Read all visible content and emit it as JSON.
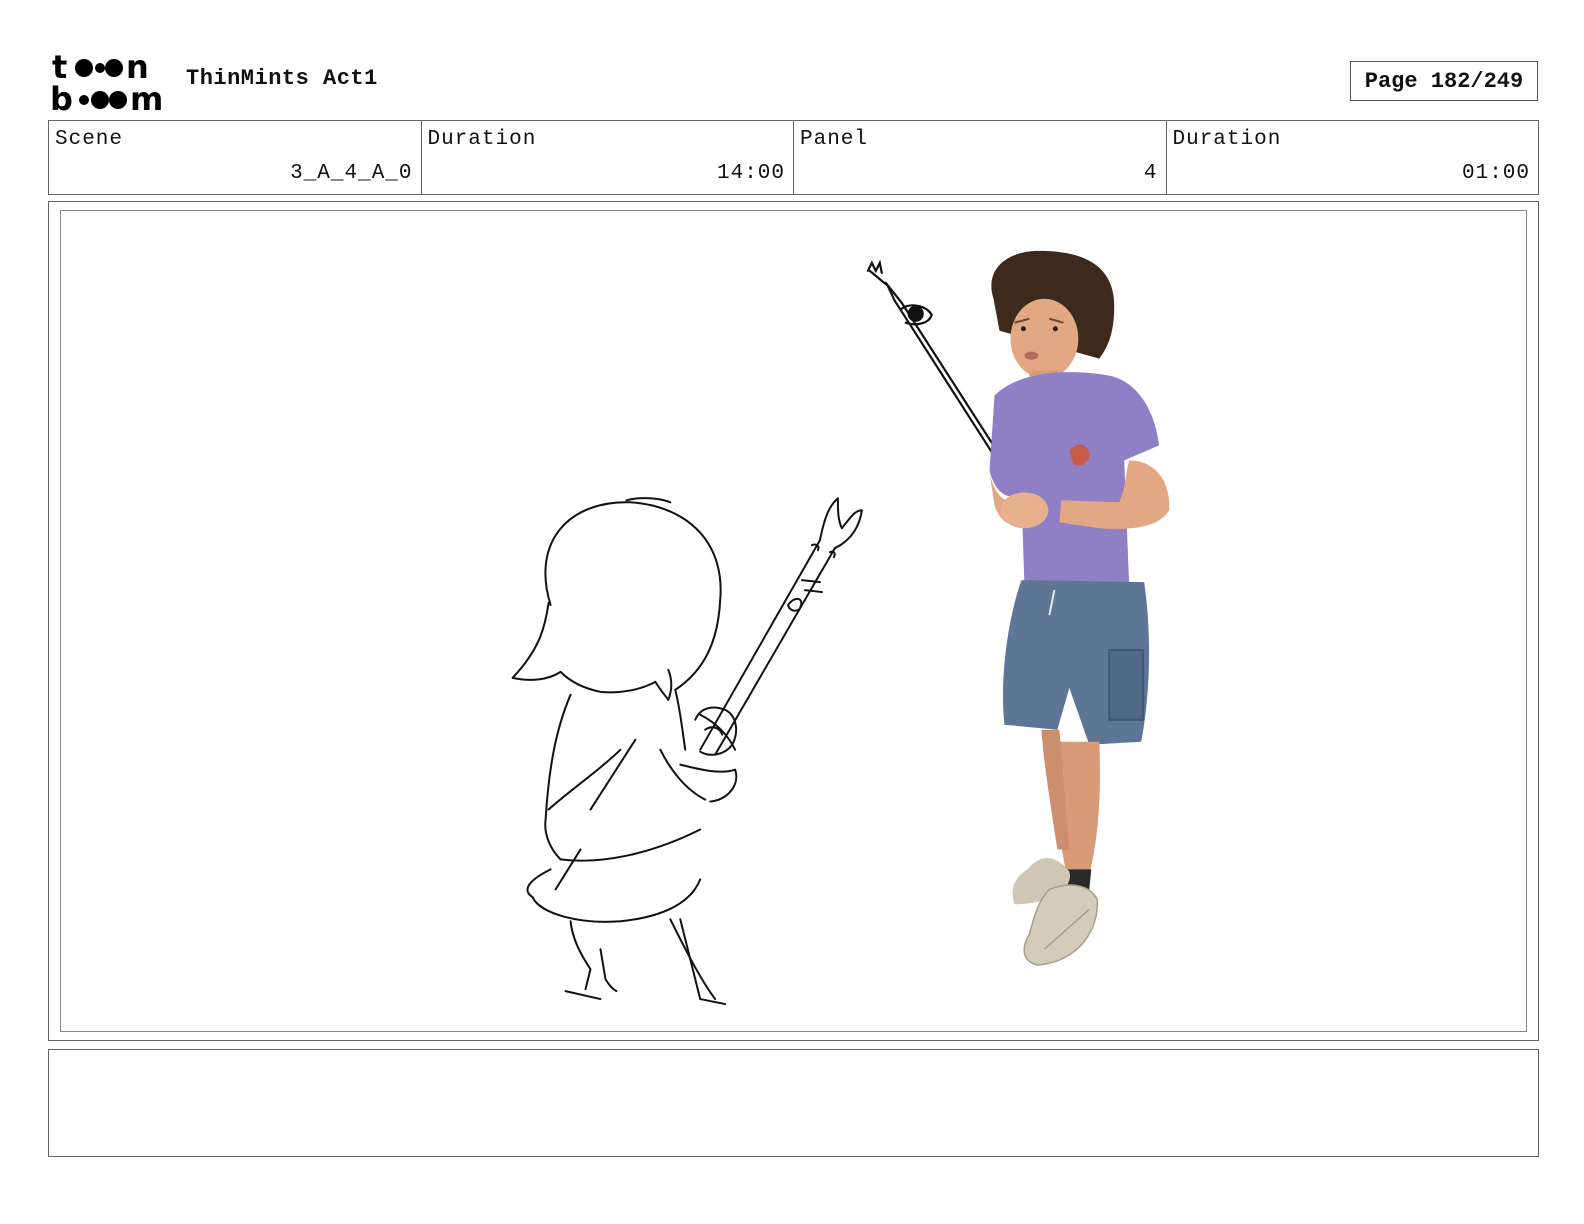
{
  "header": {
    "logo_text": "toon boom",
    "project_title": "ThinMints Act1",
    "page_label": "Page 182/249"
  },
  "info": {
    "scene_label": "Scene",
    "scene_value": "3_A_4_A_0",
    "scene_duration_label": "Duration",
    "scene_duration_value": "14:00",
    "panel_label": "Panel",
    "panel_value": "4",
    "panel_duration_label": "Duration",
    "panel_duration_value": "01:00"
  },
  "panel_image": {
    "sketch_figure": "girl-with-staff-sketch",
    "photo_figure": "boy-in-purple-shirt-holding-stick"
  },
  "notes": {
    "text": ""
  },
  "colors": {
    "border": "#666666",
    "shirt": "#8f7fc4",
    "shorts": "#5d7695",
    "hair": "#3d2a1c",
    "skin": "#e2a884"
  }
}
